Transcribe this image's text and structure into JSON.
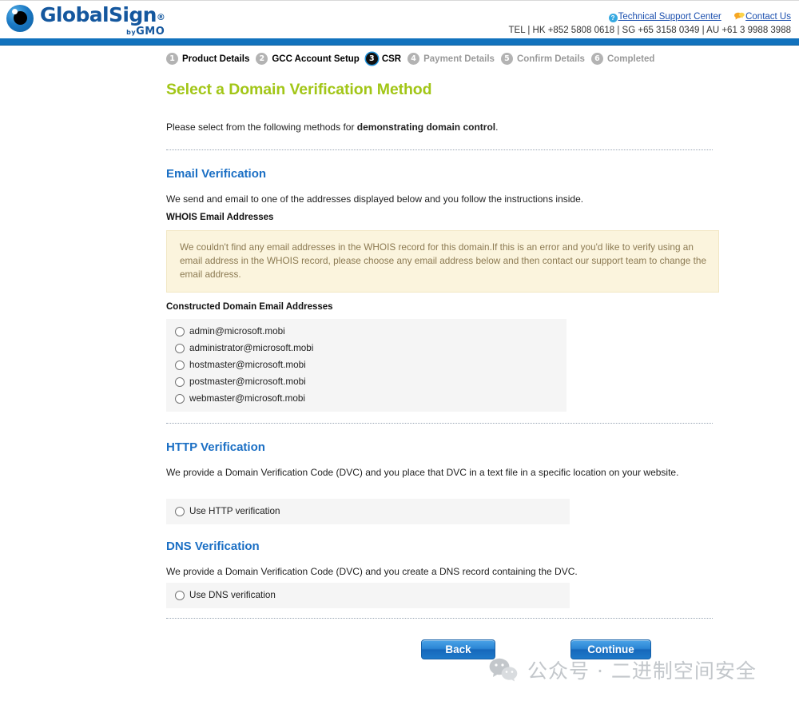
{
  "header": {
    "logo": {
      "main_text": "GlobalSign",
      "registered_mark": "®",
      "by_prefix": "by",
      "parent_brand": "GMO",
      "eye_icon": "globalsign-eye-icon"
    },
    "links": [
      {
        "icon": "help-question-icon",
        "label": "Technical Support Center"
      },
      {
        "icon": "contact-chat-icon",
        "label": "Contact Us"
      }
    ],
    "telephone": {
      "prefix": "TEL |",
      "entries": [
        {
          "region": "HK",
          "number": "+852 5808 0618"
        },
        {
          "region": "SG",
          "number": "+65 3158 0349"
        },
        {
          "region": "AU",
          "number": "+61 3 9988 3988"
        }
      ],
      "full_text": "TEL | HK +852 5808 0618 | SG +65 3158 0349 | AU +61 3 9988 3988"
    }
  },
  "steps": [
    {
      "number": "1",
      "label": "Product Details",
      "state": "done"
    },
    {
      "number": "2",
      "label": "GCC Account Setup",
      "state": "done"
    },
    {
      "number": "3",
      "label": "CSR",
      "state": "active"
    },
    {
      "number": "4",
      "label": "Payment Details",
      "state": "pending"
    },
    {
      "number": "5",
      "label": "Confirm Details",
      "state": "pending"
    },
    {
      "number": "6",
      "label": "Completed",
      "state": "pending"
    }
  ],
  "page": {
    "title": "Select a Domain Verification Method",
    "intro_prefix": "Please select from the following methods for ",
    "intro_bold": "demonstrating domain control",
    "intro_suffix": "."
  },
  "email_section": {
    "title": "Email Verification",
    "description": "We send and email to one of the addresses displayed below and you follow the instructions inside.",
    "whois_label": "WHOIS Email Addresses",
    "alert_text": "We couldn't find any email addresses in the WHOIS record for this domain.If this is an error and you'd like to verify using an email address in the WHOIS record, please choose any email address below and then contact our support team to change the email address.",
    "constructed_label": "Constructed Domain Email Addresses",
    "options": [
      "admin@microsoft.mobi",
      "administrator@microsoft.mobi",
      "hostmaster@microsoft.mobi",
      "postmaster@microsoft.mobi",
      "webmaster@microsoft.mobi"
    ]
  },
  "http_section": {
    "title": "HTTP Verification",
    "description": "We provide a Domain Verification Code (DVC) and you place that DVC in a text file in a specific location on your website.",
    "option": "Use HTTP verification"
  },
  "dns_section": {
    "title": "DNS Verification",
    "description": "We provide a Domain Verification Code (DVC) and you create a DNS record containing the DVC.",
    "option": "Use DNS verification"
  },
  "buttons": {
    "back": "Back",
    "continue": "Continue"
  },
  "watermark": {
    "icon": "wechat-icon",
    "text": "公众号 · 二进制空间安全"
  },
  "colors": {
    "brand_blue": "#14579e",
    "bar_blue": "#1272bd",
    "section_heading": "#1b6fc4",
    "page_title_green": "#a2c617",
    "alert_bg": "#fbf4dd",
    "alert_text": "#8c7a52",
    "radio_box_bg": "#f5f5f5",
    "button_blue": "#1668bb"
  }
}
